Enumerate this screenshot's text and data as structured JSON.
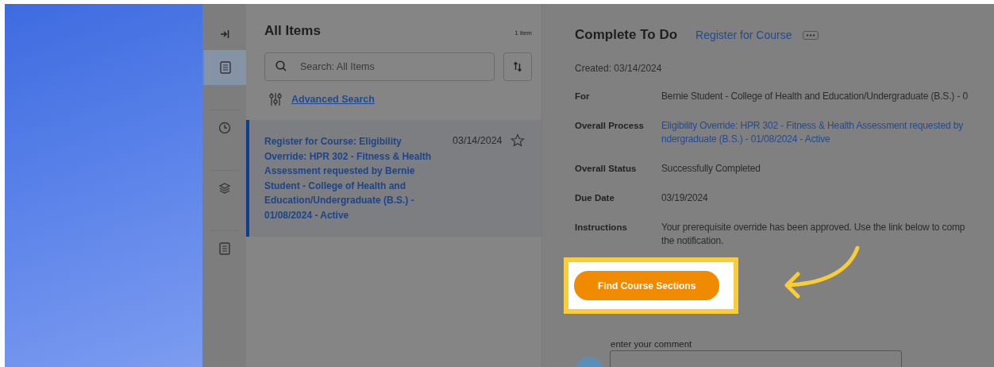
{
  "rail": {
    "items": [
      {
        "kind": "collapse",
        "selected": false
      },
      {
        "kind": "inbox",
        "selected": true
      },
      {
        "kind": "clock",
        "selected": false
      },
      {
        "kind": "layers",
        "selected": false
      },
      {
        "kind": "clipboard",
        "selected": false
      }
    ]
  },
  "list": {
    "title": "All Items",
    "count": "1 item",
    "search": {
      "placeholder": "Search: All Items"
    },
    "advanced_search": "Advanced Search",
    "items": [
      {
        "title": "Register for Course: Eligibility Override: HPR 302 - Fitness & Health Assessment requested by Bernie Student - College of Health and Education/Undergraduate (B.S.) - 01/08/2024 - Active",
        "date": "03/14/2024",
        "starred": false,
        "selected": true
      }
    ]
  },
  "detail": {
    "title": "Complete To Do",
    "link": "Register for Course",
    "created": "Created: 03/14/2024",
    "fields": [
      {
        "label": "For",
        "kind": "text",
        "lines": [
          "Bernie Student - College of Health and Education/Undergraduate (B.S.) - 0"
        ]
      },
      {
        "label": "Overall Process",
        "kind": "link",
        "lines": [
          "Eligibility Override: HPR 302 - Fitness & Health Assessment requested by",
          "ndergraduate (B.S.) - 01/08/2024 - Active"
        ]
      },
      {
        "label": "Overall Status",
        "kind": "text",
        "lines": [
          "Successfully Completed"
        ]
      },
      {
        "label": "Due Date",
        "kind": "text",
        "lines": [
          "03/19/2024"
        ]
      },
      {
        "label": "Instructions",
        "kind": "text",
        "lines": [
          "Your prerequisite override has been approved. Use the link below to comp",
          "the notification."
        ]
      }
    ],
    "button": "Find Course Sections",
    "highlighted": true,
    "comment_label": "enter your comment"
  }
}
